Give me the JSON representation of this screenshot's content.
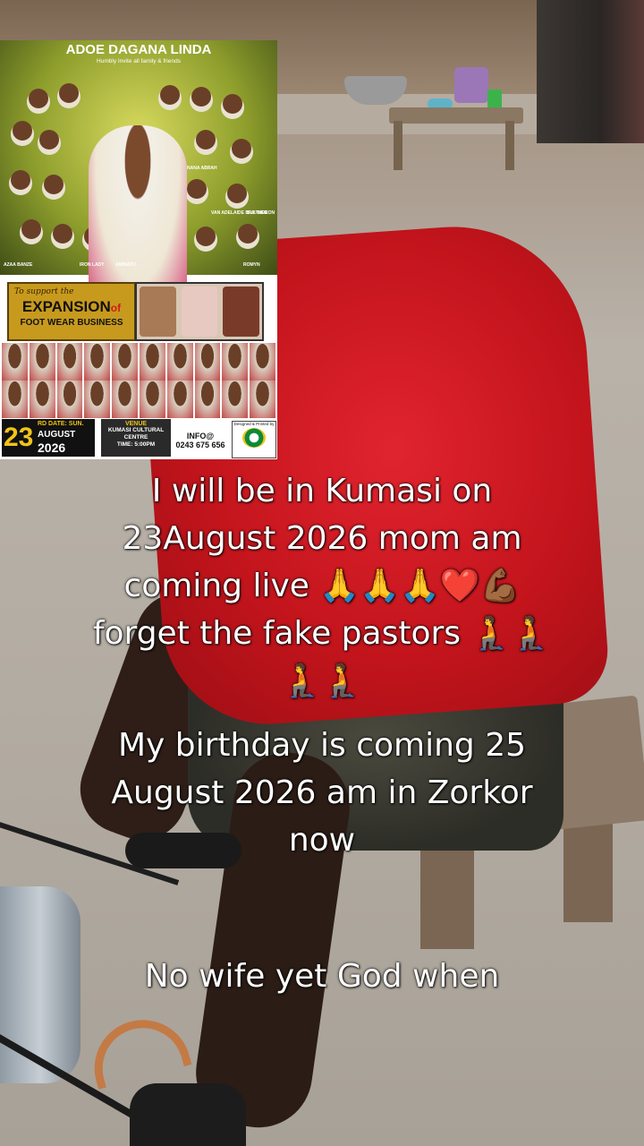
{
  "poster": {
    "title": "ADOE DAGANA LINDA",
    "subtitle": "Humbly Invite all family & friends",
    "support_label": "To support the",
    "expansion_word": "EXPANSION",
    "expansion_of": "of",
    "business_line": "FOOT WEAR BUSINESS",
    "labels": [
      "IRON LADY",
      "AMINATU",
      "ROMYN",
      "VAN ADELAIDE BROTHER",
      "B.A. GIDEON",
      "NANA ABRAH",
      "AZAA BANZE"
    ],
    "date_day": "23",
    "date_suffix": "RD",
    "date_weekday": "DATE: SUN.",
    "date_month": "AUGUST",
    "date_year": "2026",
    "venue_heading": "VENUE",
    "venue_line1": "KUMASI CULTURAL",
    "venue_line2": "CENTRE",
    "venue_time": "TIME: 5:00PM",
    "info_heading": "INFO@",
    "info_phone": "0243 675 656",
    "designer_label": "Designed & Printed by"
  },
  "captions": {
    "line1": "I will be in Kumasi on",
    "line2": "23August 2026 mom am",
    "line3_text": "coming live",
    "line3_emoji": "🙏🙏🙏❤️💪🏾",
    "line4_text": "forget the fake pastors",
    "line4_emoji": "🧎🧎",
    "line5_emoji": "🧎🧎",
    "line6": "My birthday is coming 25",
    "line7": "August 2026 am in Zorkor",
    "line8": "now",
    "line9": "No wife yet God when"
  },
  "colors": {
    "hoodie": "#c3141c",
    "poster_green": "#8e9e2c",
    "poster_gold": "#c79a1e",
    "date_gold": "#f0c419"
  }
}
